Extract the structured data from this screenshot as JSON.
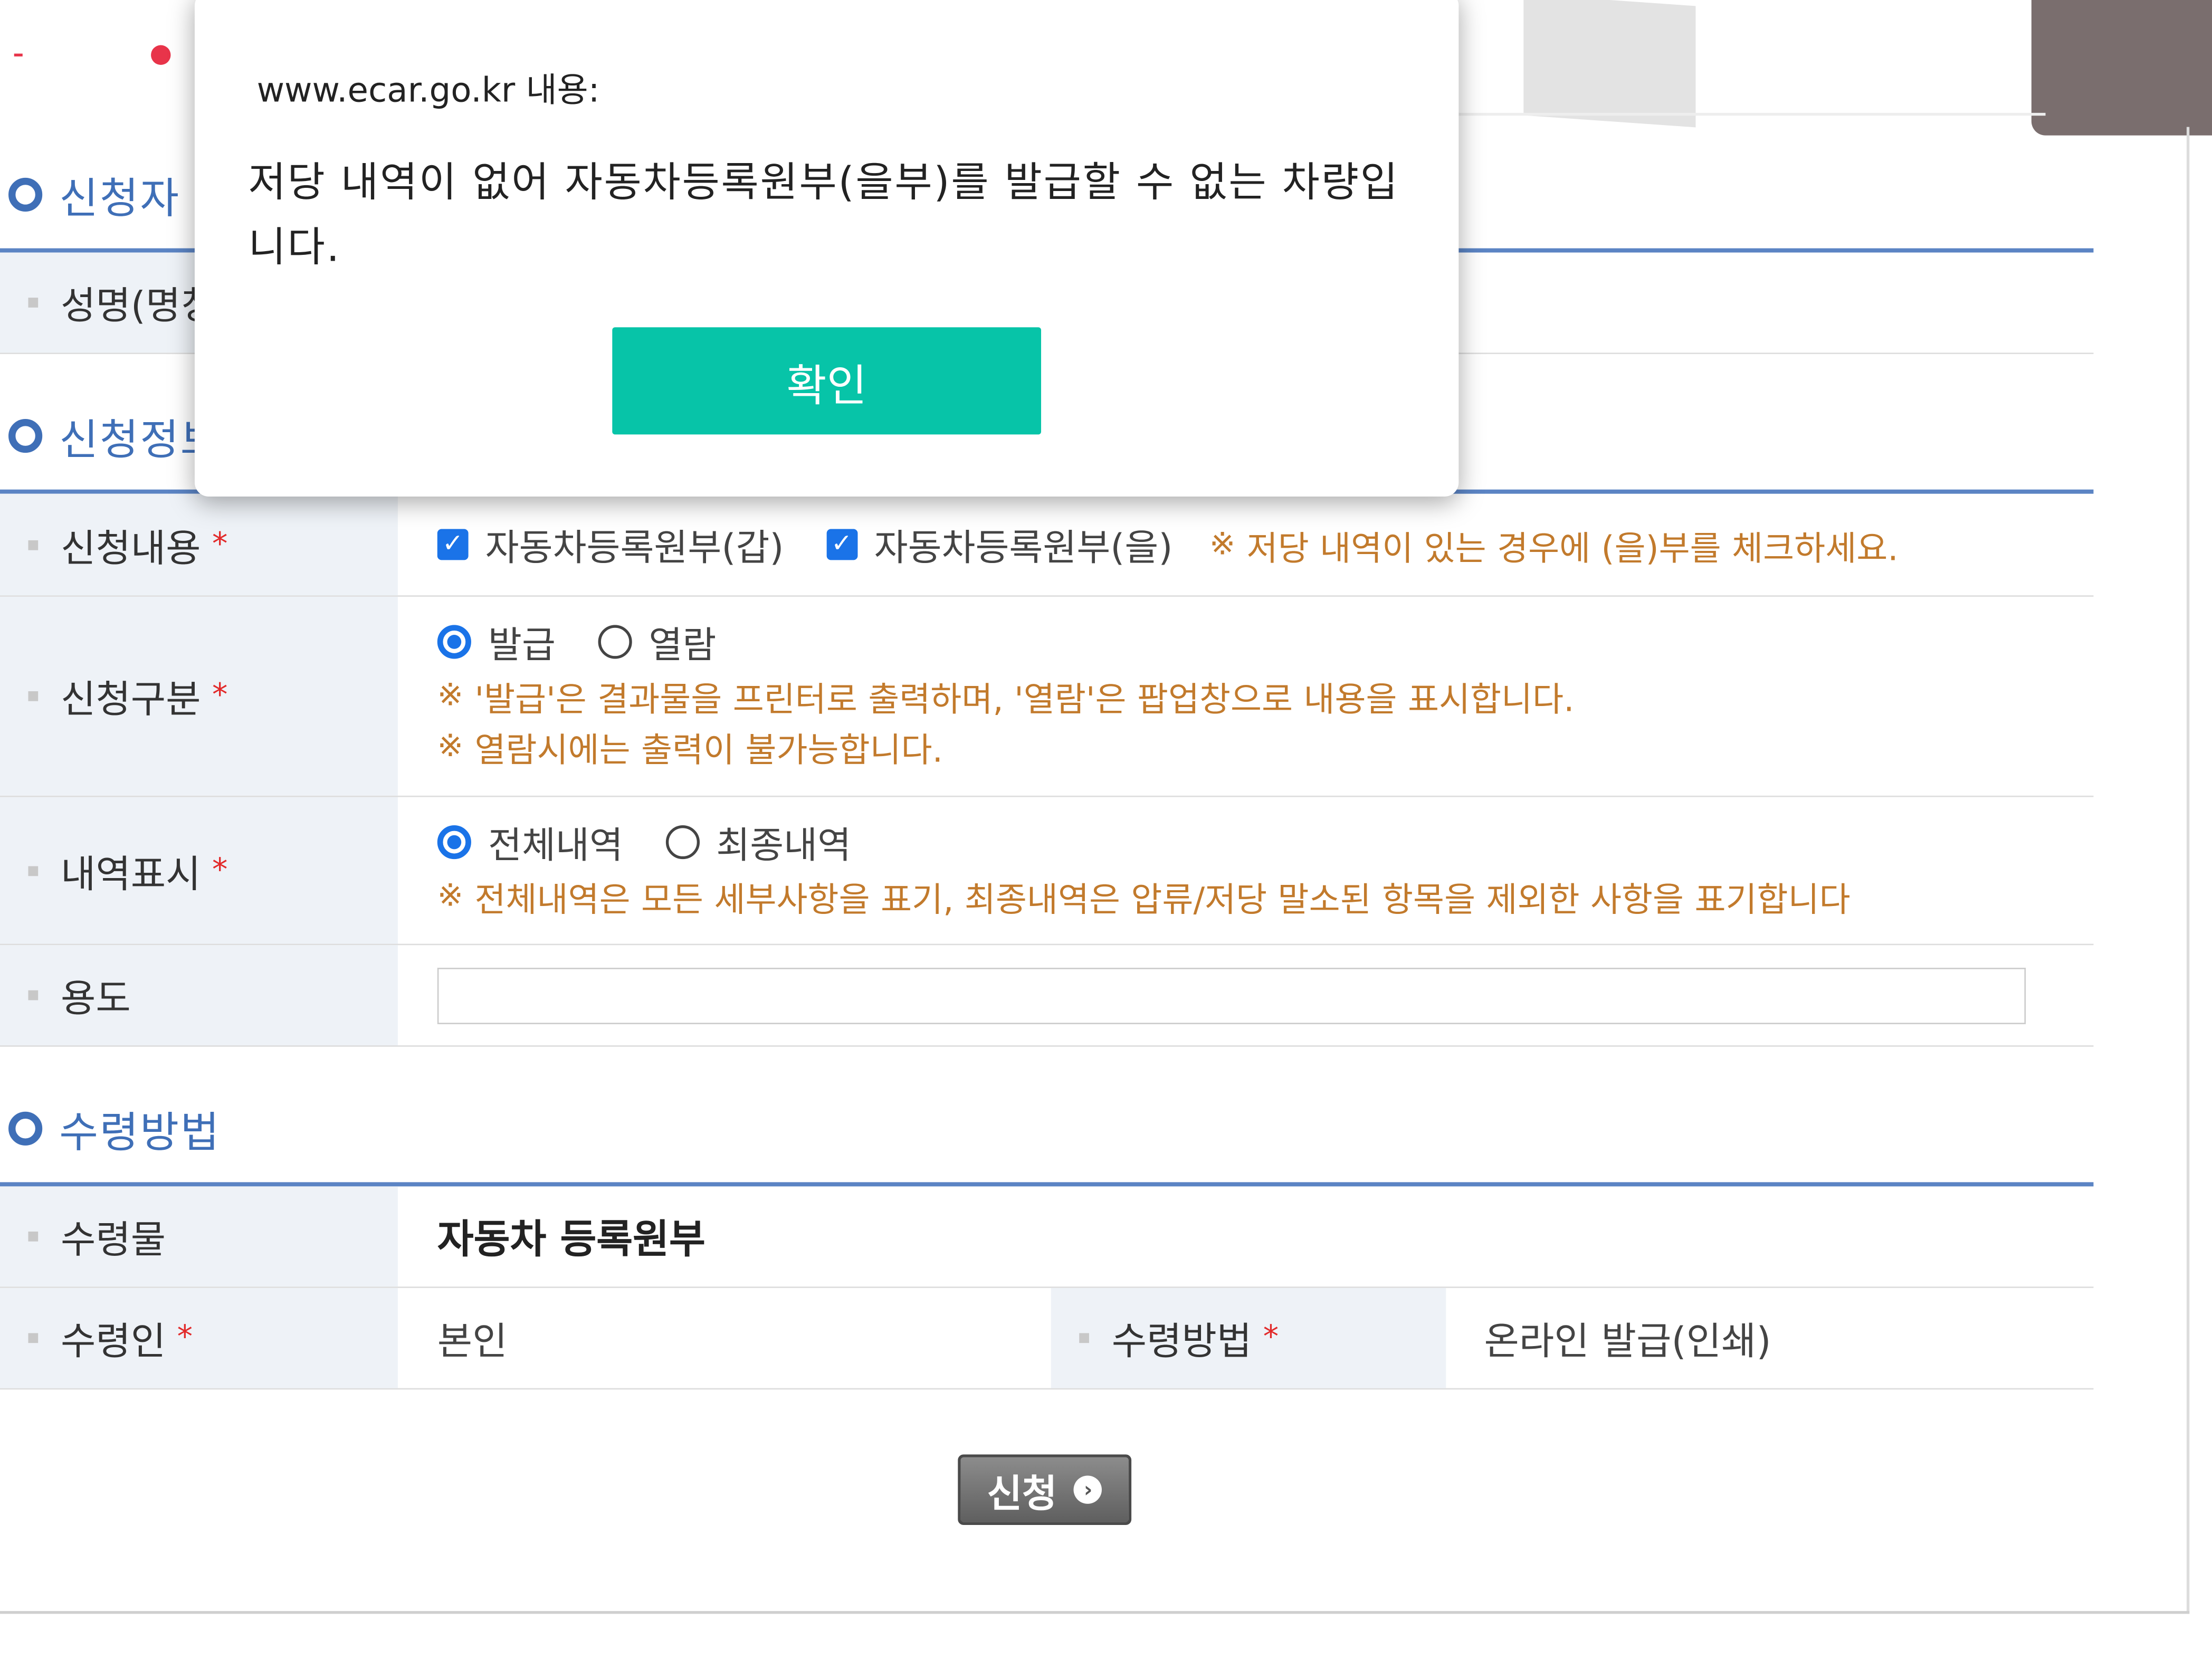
{
  "dialog": {
    "origin": "www.ecar.go.kr 내용:",
    "message": "저당 내역이 없어 자동차등록원부(을부)를 발급할 수 없는 차량입니다.",
    "ok_label": "확인"
  },
  "sections": {
    "applicant_title": "신청자",
    "application_title": "신청정보",
    "receipt_title": "수령방법"
  },
  "applicant": {
    "name_label": "성명(명칭)"
  },
  "application": {
    "content_label": "신청내용",
    "content_option_a": "자동차등록원부(갑)",
    "content_option_b": "자동차등록원부(을)",
    "content_note": "저당 내역이 있는 경우에 (을)부를 체크하세요.",
    "type_label": "신청구분",
    "type_option_issue": "발급",
    "type_option_view": "열람",
    "type_note_1": "'발급'은 결과물을 프린터로 출력하며, '열람'은 팝업창으로 내용을 표시합니다.",
    "type_note_2": "열람시에는 출력이 불가능합니다.",
    "display_label": "내역표시",
    "display_option_all": "전체내역",
    "display_option_final": "최종내역",
    "display_note": "전체내역은 모든 세부사항을 표기, 최종내역은 압류/저당 말소된 항목을 제외한 사항을 표기합니다",
    "purpose_label": "용도",
    "purpose_value": ""
  },
  "receipt": {
    "item_label": "수령물",
    "item_value": "자동차 등록원부",
    "recipient_label": "수령인",
    "recipient_value": "본인",
    "method_label": "수령방법",
    "method_value": "온라인 발급(인쇄)"
  },
  "required_mark": "*",
  "note_mark": "※",
  "submit_label": "신청",
  "icons": {
    "checkbox_checked": "✓",
    "arrow": "›"
  },
  "colors": {
    "accent_blue": "#3f6fb7",
    "confirm_green": "#07c4a8",
    "note_orange": "#c27a2c",
    "required_red": "#e22a2a"
  }
}
